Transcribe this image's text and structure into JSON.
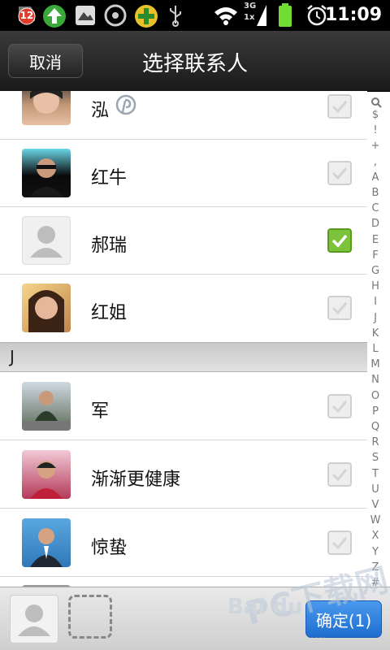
{
  "status_bar": {
    "notification_count": "12",
    "net_label_top": "3G",
    "net_label_bottom": "1x",
    "time": "11:09",
    "icons": [
      "notification-badge-icon",
      "upload-arrow-icon",
      "gallery-icon",
      "disc-icon",
      "add-app-icon",
      "usb-icon",
      "wifi-icon",
      "signal-icon",
      "battery-icon",
      "alarm-clock-icon"
    ]
  },
  "title_bar": {
    "cancel_label": "取消",
    "title": "选择联系人"
  },
  "contacts": [
    {
      "name": "泓",
      "checked": false,
      "avatar": "photo-woman",
      "extra_icon": "pinterest-icon"
    },
    {
      "name": "红牛",
      "checked": false,
      "avatar": "photo-man-sunglasses"
    },
    {
      "name": "郝瑞",
      "checked": true,
      "avatar": "default-person-icon"
    },
    {
      "name": "红姐",
      "checked": false,
      "avatar": "photo-woman-2"
    }
  ],
  "section_header": "J",
  "contacts_j": [
    {
      "name": "军",
      "checked": false,
      "avatar": "photo-child"
    },
    {
      "name": "渐渐更健康",
      "checked": false,
      "avatar": "photo-man-red"
    },
    {
      "name": "惊蛰",
      "checked": false,
      "avatar": "photo-man-suit"
    }
  ],
  "index_letters": [
    "$",
    "!",
    "+",
    ",",
    "A",
    "B",
    "C",
    "D",
    "E",
    "F",
    "G",
    "H",
    "I",
    "J",
    "K",
    "L",
    "M",
    "N",
    "O",
    "P",
    "Q",
    "R",
    "S",
    "T",
    "U",
    "V",
    "W",
    "X",
    "Y",
    "Z",
    "#"
  ],
  "bottom_bar": {
    "confirm_label": "确定(1)"
  },
  "watermark": {
    "text": "PC下载网",
    "subtext": "jingyan.baidu.com",
    "brand": "Bai du"
  },
  "colors": {
    "check_on": "#7cc23a",
    "confirm_button": "#2a7fe0",
    "titlebar": "#2a2a2a"
  }
}
